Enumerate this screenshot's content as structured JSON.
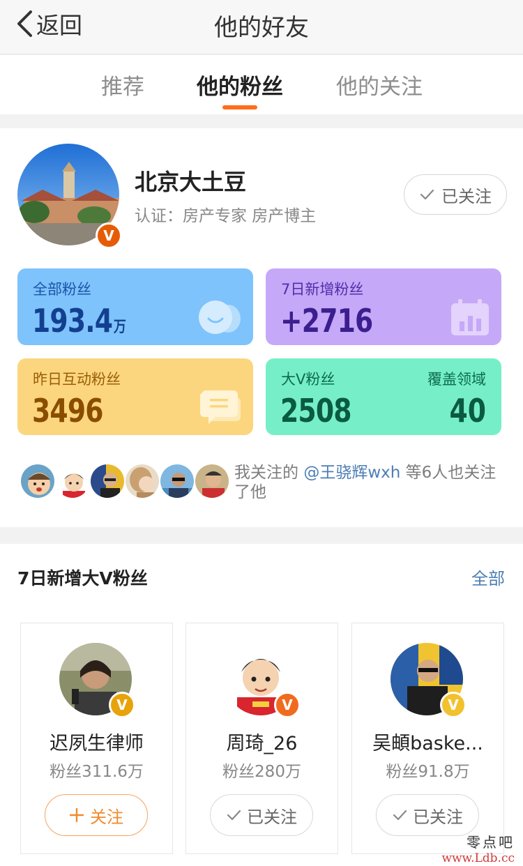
{
  "header": {
    "back_label": "返回",
    "title": "他的好友"
  },
  "tabs": [
    {
      "label": "推荐",
      "active": false
    },
    {
      "label": "他的粉丝",
      "active": true
    },
    {
      "label": "他的关注",
      "active": false
    }
  ],
  "profile": {
    "name": "北京大土豆",
    "certification": "认证：房产专家 房产博主",
    "follow_status": "已关注"
  },
  "stats": {
    "all_fans": {
      "label": "全部粉丝",
      "value": "193.4",
      "unit": "万"
    },
    "new_7d": {
      "label": "7日新增粉丝",
      "value": "+2716"
    },
    "yesterday_interactive": {
      "label": "昨日互动粉丝",
      "value": "3496"
    },
    "big_v": {
      "label": "大V粉丝",
      "value": "2508",
      "domain_label": "覆盖领域",
      "domain_value": "40"
    }
  },
  "mutual": {
    "prefix": "我关注的",
    "link": "@王骁辉wxh",
    "suffix": "等6人也关注了他"
  },
  "section": {
    "title": "7日新增大V粉丝",
    "all_label": "全部",
    "cards": [
      {
        "name": "迟夙生律师",
        "fans": "粉丝311.6万",
        "button": "关注",
        "followed": false
      },
      {
        "name": "周琦_26",
        "fans": "粉丝280万",
        "button": "已关注",
        "followed": true
      },
      {
        "name": "吴頔baske...",
        "fans": "粉丝91.8万",
        "button": "已关注",
        "followed": true
      }
    ]
  },
  "watermark": {
    "line1": "零点吧",
    "line2": "www.Ldb.cc"
  },
  "colors": {
    "accent": "#ff6d1a",
    "link": "#4c7eb5",
    "card_blue": "#7ec3fb",
    "card_purple": "#c6a8f8",
    "card_yellow": "#fcd67e",
    "card_green": "#76efc8"
  }
}
